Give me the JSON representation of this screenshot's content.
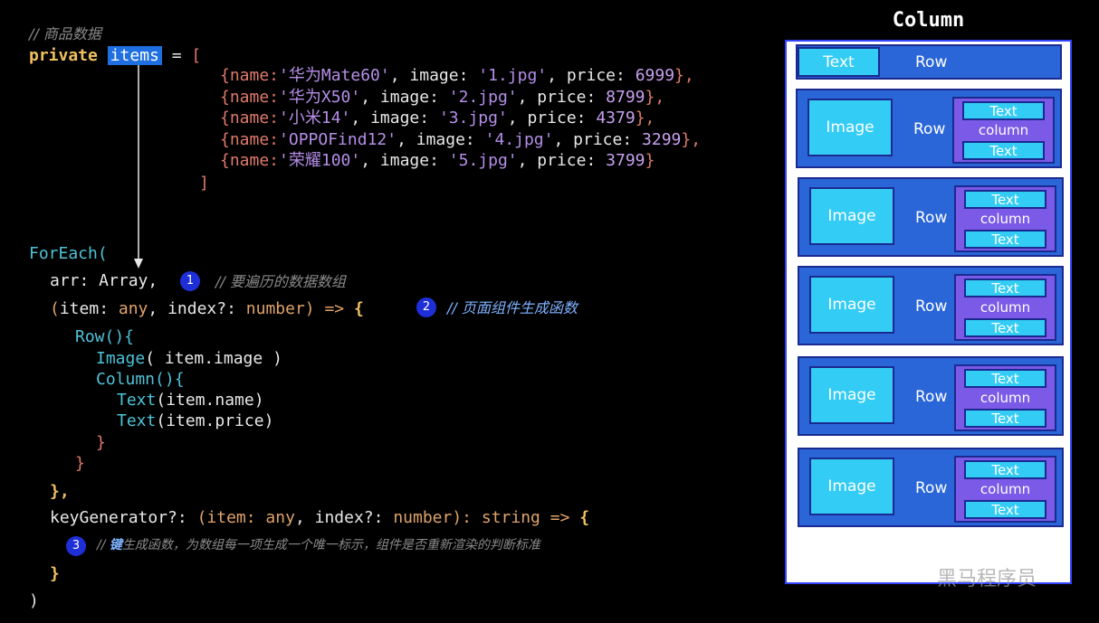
{
  "code": {
    "comment_goods": "// 商品数据",
    "private_kw": "private",
    "items_var": "items",
    "assign": " = ",
    "open_bracket": "[",
    "close_bracket": "]",
    "item_lines": [
      {
        "pre": "{name:",
        "name": "'华为Mate60'",
        "mid": ", image: ",
        "img": "'1.jpg'",
        "mid2": ", price: ",
        "price": "6999",
        "post": "},"
      },
      {
        "pre": "{name:",
        "name": "'华为X50'",
        "mid": ", image: ",
        "img": "'2.jpg'",
        "mid2": ", price: ",
        "price": "8799",
        "post": "},"
      },
      {
        "pre": "{name:",
        "name": "'小米14'",
        "mid": ", image: ",
        "img": "'3.jpg'",
        "mid2": ", price: ",
        "price": "4379",
        "post": "},"
      },
      {
        "pre": "{name:",
        "name": "'OPPOFind12'",
        "mid": ", image: ",
        "img": "'4.jpg'",
        "mid2": ", price: ",
        "price": "3299",
        "post": "},"
      },
      {
        "pre": "{name:",
        "name": "'荣耀100'",
        "mid": ", image: ",
        "img": "'5.jpg'",
        "mid2": ", price: ",
        "price": "3799",
        "post": "}"
      }
    ],
    "foreach": "ForEach(",
    "arr_line": "arr: Array,",
    "arr_comment": "// 要遍历的数据数组",
    "item_fn_open": "(",
    "item_fn_item": "item: ",
    "item_fn_any": "any",
    "item_fn_index": ", index?: ",
    "item_fn_number": "number",
    "item_fn_close": ") => ",
    "brace_open": "{",
    "item_fn_comment": "// 页面组件生成函数",
    "row_call": "Row(){",
    "image_call": "Image",
    "image_arg": "( item.image )",
    "column_call": "Column(){",
    "text_name": "Text",
    "text_name_arg": "(item.name)",
    "text_price": "Text",
    "text_price_arg": "(item.price)",
    "close1": "}",
    "close2": "}",
    "close3": "},",
    "keygen": "keyGenerator?: ",
    "keygen_params_open": "(item: ",
    "keygen_any": "any",
    "keygen_index": ", index?: ",
    "keygen_number": "number",
    "keygen_close": "): ",
    "keygen_string": "string",
    "keygen_arrow": " => ",
    "keygen_comment_key": "键",
    "keygen_comment": "生成函数，为数组每一项生成一个唯一标示，组件是否重新渲染的判断标准",
    "keygen_comment_prefix": "// ",
    "close_brace": "}",
    "close_paren": ")"
  },
  "badges": [
    "1",
    "2",
    "3"
  ],
  "diagram": {
    "title": "Column",
    "header_row": {
      "text": "Text",
      "row": "Row"
    },
    "rows": [
      {
        "image": "Image",
        "row": "Row",
        "t1": "Text",
        "col": "column",
        "t2": "Text"
      },
      {
        "image": "Image",
        "row": "Row",
        "t1": "Text",
        "col": "column",
        "t2": "Text"
      },
      {
        "image": "Image",
        "row": "Row",
        "t1": "Text",
        "col": "column",
        "t2": "Text"
      },
      {
        "image": "Image",
        "row": "Row",
        "t1": "Text",
        "col": "column",
        "t2": "Text"
      },
      {
        "image": "Image",
        "row": "Row",
        "t1": "Text",
        "col": "column",
        "t2": "Text"
      }
    ]
  },
  "watermark": "黑马程序员"
}
